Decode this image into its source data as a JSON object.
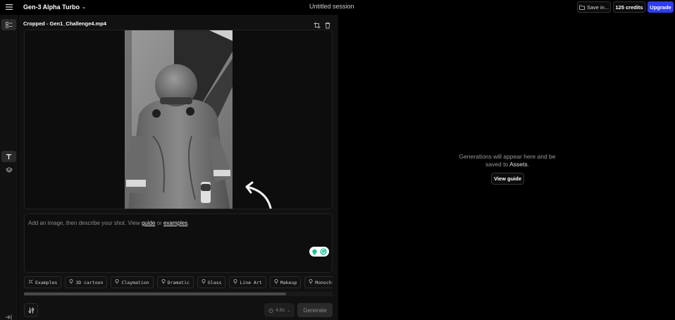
{
  "topbar": {
    "model": "Gen-3 Alpha Turbo",
    "session_title": "Untitled session",
    "save_label": "Save in...",
    "credits_label": "125 credits",
    "upgrade_label": "Upgrade"
  },
  "editor": {
    "file_name": "Cropped - Gen1_Challenge4.mp4",
    "prompt": {
      "before": "Add an image, then describe your shot. View ",
      "guide_link": "guide",
      "middle": " or ",
      "examples_link": "examples",
      "after": "."
    },
    "chips": [
      {
        "label": "Examples",
        "icon": "sparkle-icon"
      },
      {
        "label": "3D cartoon",
        "icon": "bulb-icon"
      },
      {
        "label": "Claymation",
        "icon": "bulb-icon"
      },
      {
        "label": "Dramatic",
        "icon": "bulb-icon"
      },
      {
        "label": "Glass",
        "icon": "bulb-icon"
      },
      {
        "label": "Line Art",
        "icon": "bulb-icon"
      },
      {
        "label": "Makeup",
        "icon": "bulb-icon"
      },
      {
        "label": "Monochrome",
        "icon": "bulb-icon"
      }
    ],
    "duration_label": "4.8s",
    "generate_label": "Generate"
  },
  "results": {
    "empty_line1": "Generations will appear here and be saved to ",
    "empty_assets": "Assets",
    "empty_end": ".",
    "view_guide_label": "View guide"
  },
  "colors": {
    "accent": "#2f3cf2",
    "panel_bg": "#111111",
    "page_bg": "#000000"
  }
}
